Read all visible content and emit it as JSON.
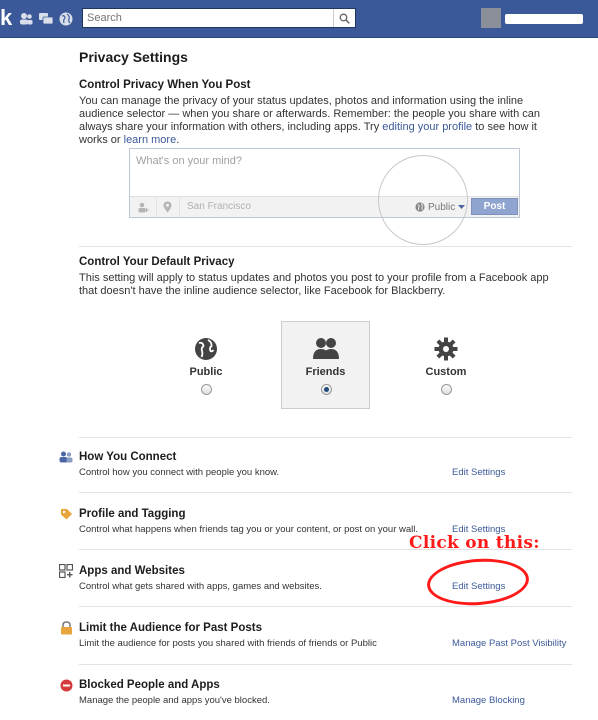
{
  "topbar": {
    "logo": "k",
    "search_placeholder": "Search"
  },
  "page": {
    "title": "Privacy Settings"
  },
  "post_section": {
    "heading": "Control Privacy When You Post",
    "desc_1": "You can manage the privacy of your status updates, photos and information using the inline audience selector — when you share or afterwards. Remember: the people you share with can always share your information with others, including apps. Try ",
    "link_1": "editing your profile",
    "desc_2": " to see how it works or ",
    "link_2": "learn more",
    "desc_3": "."
  },
  "composer": {
    "placeholder": "What's on your mind?",
    "location": "San Francisco",
    "audience": "Public",
    "post_label": "Post"
  },
  "default_privacy": {
    "heading": "Control Your Default Privacy",
    "desc": "This setting will apply to status updates and photos you post to your profile from a Facebook app that doesn't have the inline audience selector, like Facebook for Blackberry.",
    "options": [
      {
        "label": "Public",
        "icon": "globe-icon",
        "selected": false
      },
      {
        "label": "Friends",
        "icon": "friends-icon",
        "selected": true
      },
      {
        "label": "Custom",
        "icon": "gear-icon",
        "selected": false
      }
    ]
  },
  "sections": [
    {
      "title": "How You Connect",
      "desc": "Control how you connect with people you know.",
      "link": "Edit Settings",
      "icon": "people-icon"
    },
    {
      "title": "Profile and Tagging",
      "desc": "Control what happens when friends tag you or your content, or post on your wall.",
      "link": "Edit Settings",
      "icon": "tag-icon"
    },
    {
      "title": "Apps and Websites",
      "desc": "Control what gets shared with apps, games and websites.",
      "link": "Edit Settings",
      "icon": "apps-icon"
    },
    {
      "title": "Limit the Audience for Past Posts",
      "desc": "Limit the audience for posts you shared with friends of friends or Public",
      "link": "Manage Past Post Visibility",
      "icon": "lock-icon"
    },
    {
      "title": "Blocked People and Apps",
      "desc": "Manage the people and apps you've blocked.",
      "link": "Manage Blocking",
      "icon": "block-icon"
    }
  ],
  "annotation": {
    "text": "Click on this:",
    "color": "#ff1a1a"
  },
  "colors": {
    "brand": "#3b5998",
    "link": "#3b5998"
  }
}
